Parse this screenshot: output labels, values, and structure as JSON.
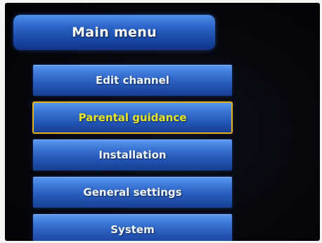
{
  "title": "Main menu",
  "menu": {
    "items": [
      {
        "label": "Edit channel"
      },
      {
        "label": "Parental guidance"
      },
      {
        "label": "Installation"
      },
      {
        "label": "General settings"
      },
      {
        "label": "System"
      }
    ],
    "selected_index": 1
  },
  "colors": {
    "button_blue": "#2b64c8",
    "selected_outline": "#e6b21a",
    "selected_text": "#e8e62a",
    "background": "#05060a"
  }
}
